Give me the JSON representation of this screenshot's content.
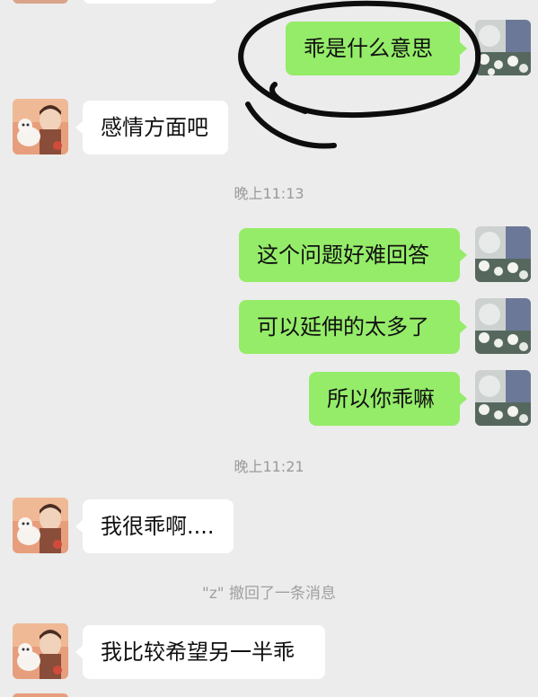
{
  "messages": {
    "m1": "乖是什么意思",
    "m2": "感情方面吧",
    "t1": "晚上11:13",
    "m3": "这个问题好难回答",
    "m4": "可以延伸的太多了",
    "m5": "所以你乖嘛",
    "t2": "晚上11:21",
    "m6": "我很乖啊....",
    "recall": "\"z\" 撤回了一条消息",
    "m7": "我比较希望另一半乖"
  },
  "colors": {
    "background": "#ececec",
    "outgoing_bubble": "#95ec69",
    "incoming_bubble": "#ffffff",
    "timestamp_text": "#9a9a9a"
  },
  "icons": {
    "incoming_avatar": "cartoon-boy-with-cat-avatar",
    "outgoing_avatar": "flowers-photo-avatar",
    "annotation": "hand-drawn-circle"
  }
}
